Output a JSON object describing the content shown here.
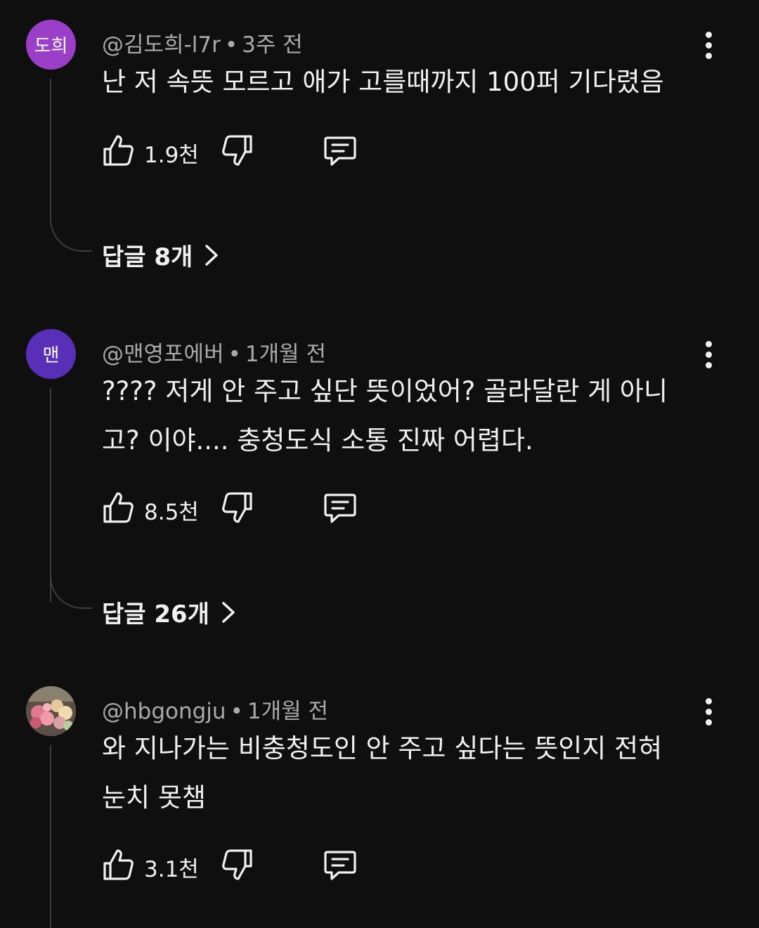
{
  "comments": [
    {
      "avatar_text": "도희",
      "avatar_color": "#9b3fc9",
      "author": "@김도희-l7r",
      "separator": "•",
      "time": "3주 전",
      "text": "난 저 속뜻 모르고 애가 고를때까지 100퍼 기다렸음",
      "likes": "1.9천",
      "replies": "답글 8개"
    },
    {
      "avatar_text": "맨",
      "avatar_color": "#5a2fb8",
      "author": "@맨영포에버",
      "separator": "•",
      "time": "1개월 전",
      "text": "???? 저게 안 주고 싶단 뜻이었어? 골라달란 게 아니고? 이야.... 충청도식 소통 진짜 어렵다.",
      "likes": "8.5천",
      "replies": "답글 26개"
    },
    {
      "avatar_text": "",
      "avatar_image": "flower-bouquet-photo",
      "author": "@hbgongju",
      "separator": "•",
      "time": "1개월 전",
      "text": "와 지나가는 비충청도인 안 주고 싶다는 뜻인지 전혀 눈치 못챔",
      "likes": "3.1천"
    }
  ],
  "icons": {
    "like": "thumbs-up-icon",
    "dislike": "thumbs-down-icon",
    "reply": "comment-reply-icon",
    "more": "more-vertical-icon",
    "chevron": "chevron-right-icon"
  }
}
